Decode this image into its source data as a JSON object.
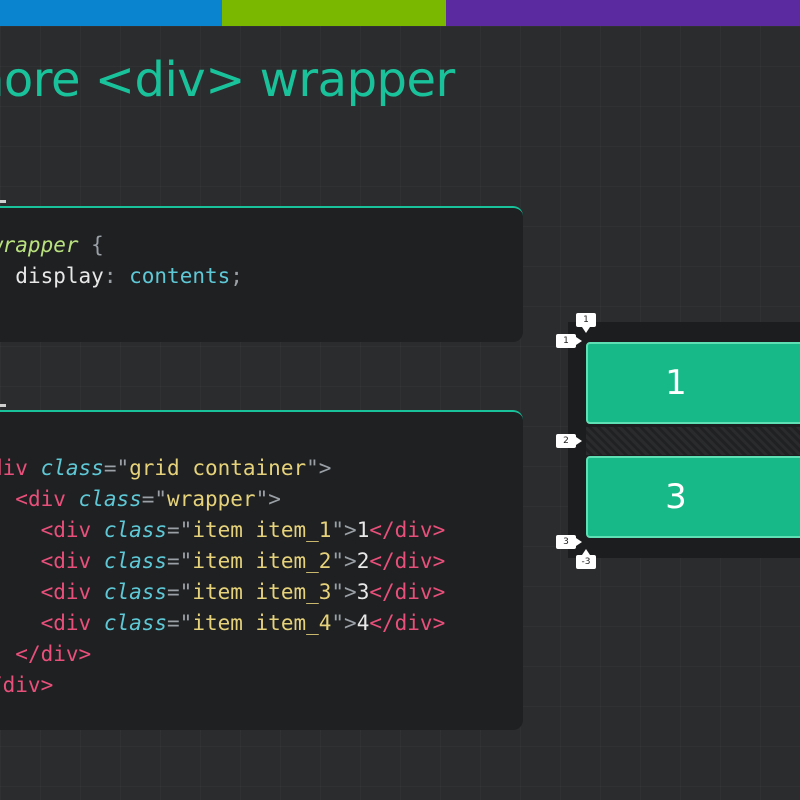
{
  "slide": {
    "title": "nore <div> wrapper"
  },
  "colors": {
    "accent": "#19c29a",
    "bar_blue": "#0a84cf",
    "bar_green": "#7ab800",
    "bar_purple": "#5b2aa0",
    "item_fill": "#16b987"
  },
  "css_code": {
    "line1": {
      "selector": "wrapper",
      "brace": "{"
    },
    "line2": {
      "property": "display",
      "colon": ":",
      "value": "contents",
      "semi": ";"
    }
  },
  "html_code": {
    "line1": {
      "open": "div",
      "attr": "class",
      "eq": "=\"",
      "val": "grid container",
      "close": "\">"
    },
    "line2": {
      "open": "<div",
      "attr": "class",
      "eq": "=\"",
      "val": "wrapper",
      "close": "\">"
    },
    "items": [
      {
        "open": "<div",
        "attr": "class",
        "eq": "=\"",
        "val": "item item_1",
        "close": "\">",
        "text": "1",
        "end": "</div>"
      },
      {
        "open": "<div",
        "attr": "class",
        "eq": "=\"",
        "val": "item item_2",
        "close": "\">",
        "text": "2",
        "end": "</div>"
      },
      {
        "open": "<div",
        "attr": "class",
        "eq": "=\"",
        "val": "item item_3",
        "close": "\">",
        "text": "3",
        "end": "</div>"
      },
      {
        "open": "<div",
        "attr": "class",
        "eq": "=\"",
        "val": "item item_4",
        "close": "\">",
        "text": "4",
        "end": "</div>"
      }
    ],
    "line7": "</div>",
    "line8": "/div>"
  },
  "demo": {
    "items": [
      "1",
      "3"
    ],
    "line_labels": {
      "top": "1",
      "left1": "1",
      "left2": "2",
      "left3": "3",
      "bottom": "-3"
    }
  }
}
